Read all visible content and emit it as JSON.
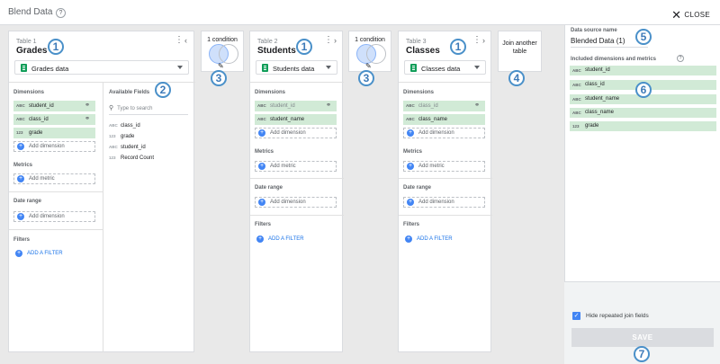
{
  "header": {
    "title": "Blend Data",
    "help_icon": "?",
    "close_label": "CLOSE",
    "close_icon": "✕"
  },
  "table1": {
    "label": "Table 1",
    "name": "Grades",
    "source": "Grades data",
    "dimensions_label": "Dimensions",
    "dimensions": [
      {
        "type": "ABC",
        "name": "student_id"
      },
      {
        "type": "ABC",
        "name": "class_id"
      },
      {
        "type": "123",
        "name": "grade"
      }
    ],
    "add_dimension": "Add dimension",
    "metrics_label": "Metrics",
    "add_metric": "Add metric",
    "date_range_label": "Date range",
    "add_date": "Add dimension",
    "filters_label": "Filters",
    "add_filter": "ADD A FILTER",
    "available_label": "Available Fields",
    "search_placeholder": "Type to search",
    "available": [
      {
        "type": "ABC",
        "name": "class_id"
      },
      {
        "type": "123",
        "name": "grade"
      },
      {
        "type": "ABC",
        "name": "student_id"
      },
      {
        "type": "123",
        "name": "Record Count"
      }
    ]
  },
  "table2": {
    "label": "Table 2",
    "name": "Students",
    "source": "Students data",
    "dimensions_label": "Dimensions",
    "dimensions": [
      {
        "type": "ABC",
        "name": "student_id"
      },
      {
        "type": "ABC",
        "name": "student_name"
      }
    ],
    "add_dimension": "Add dimension",
    "metrics_label": "Metrics",
    "add_metric": "Add metric",
    "date_range_label": "Date range",
    "add_date": "Add dimension",
    "filters_label": "Filters",
    "add_filter": "ADD A FILTER"
  },
  "table3": {
    "label": "Table 3",
    "name": "Classes",
    "source": "Classes data",
    "dimensions_label": "Dimensions",
    "dimensions": [
      {
        "type": "ABC",
        "name": "class_id"
      },
      {
        "type": "ABC",
        "name": "class_name"
      }
    ],
    "add_dimension": "Add dimension",
    "metrics_label": "Metrics",
    "add_metric": "Add metric",
    "date_range_label": "Date range",
    "add_date": "Add dimension",
    "filters_label": "Filters",
    "add_filter": "ADD A FILTER"
  },
  "join1": {
    "label": "1 condition"
  },
  "join2": {
    "label": "1 condition"
  },
  "join_another": {
    "line1": "Join another",
    "line2": "table"
  },
  "badges": {
    "b1": "1",
    "b2": "2",
    "b3": "3",
    "b4": "4",
    "b5": "5",
    "b6": "6",
    "b7": "7"
  },
  "right": {
    "ds_label": "Data source name",
    "ds_name": "Blended Data (1)",
    "included_label": "Included dimensions and metrics",
    "included": [
      {
        "type": "ABC",
        "name": "student_id"
      },
      {
        "type": "ABC",
        "name": "class_id"
      },
      {
        "type": "ABC",
        "name": "student_name"
      },
      {
        "type": "ABC",
        "name": "class_name"
      },
      {
        "type": "123",
        "name": "grade"
      }
    ],
    "hide_label": "Hide repeated join fields",
    "save_label": "SAVE"
  },
  "colors": {
    "accent": "#4285f4",
    "chip": "#d1ead6",
    "badge": "#4a90c9",
    "sheets": "#0f9d58"
  }
}
